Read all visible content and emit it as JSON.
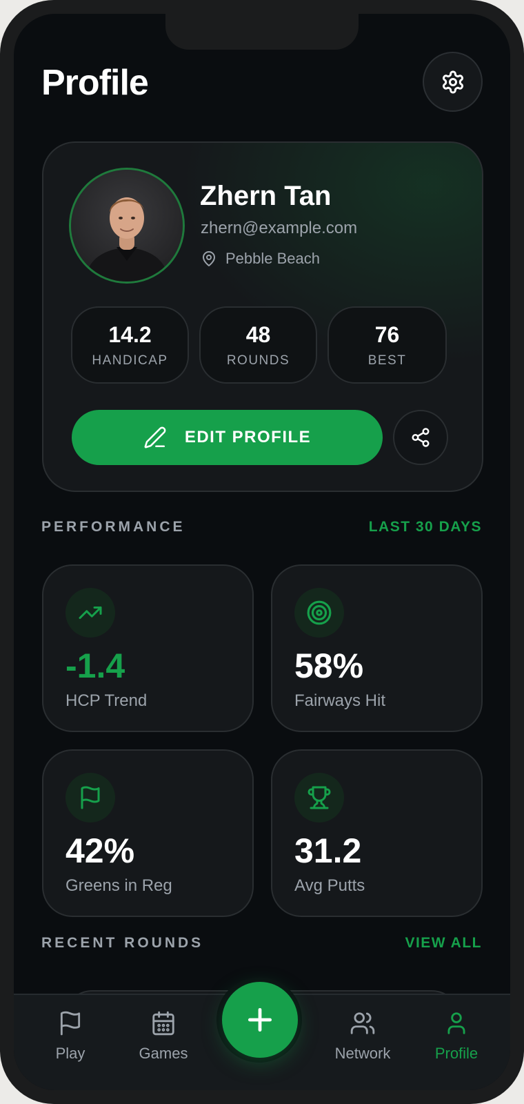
{
  "header": {
    "title": "Profile"
  },
  "profile": {
    "name": "Zhern Tan",
    "email": "zhern@example.com",
    "location": "Pebble Beach",
    "stats": [
      {
        "value": "14.2",
        "label": "HANDICAP"
      },
      {
        "value": "48",
        "label": "ROUNDS"
      },
      {
        "value": "76",
        "label": "BEST"
      }
    ],
    "edit_label": "EDIT PROFILE"
  },
  "performance": {
    "title": "PERFORMANCE",
    "range": "LAST 30 DAYS",
    "metrics": [
      {
        "icon": "trending-up-icon",
        "value": "-1.4",
        "label": "HCP Trend"
      },
      {
        "icon": "target-icon",
        "value": "58%",
        "label": "Fairways Hit"
      },
      {
        "icon": "flag-icon",
        "value": "42%",
        "label": "Greens in Reg"
      },
      {
        "icon": "trophy-icon",
        "value": "31.2",
        "label": "Avg Putts"
      }
    ]
  },
  "recent_rounds": {
    "title": "RECENT ROUNDS",
    "link": "VIEW ALL"
  },
  "nav": {
    "items": [
      {
        "label": "Play",
        "icon": "flag-icon"
      },
      {
        "label": "Games",
        "icon": "calendar-icon"
      },
      {
        "label": "Network",
        "icon": "users-icon"
      },
      {
        "label": "Profile",
        "icon": "user-icon",
        "active": true
      }
    ],
    "fab_icon": "plus-icon"
  },
  "colors": {
    "accent": "#16a04b",
    "background": "#0a0d10",
    "card": "#15181b",
    "muted": "#9ca3ab"
  }
}
